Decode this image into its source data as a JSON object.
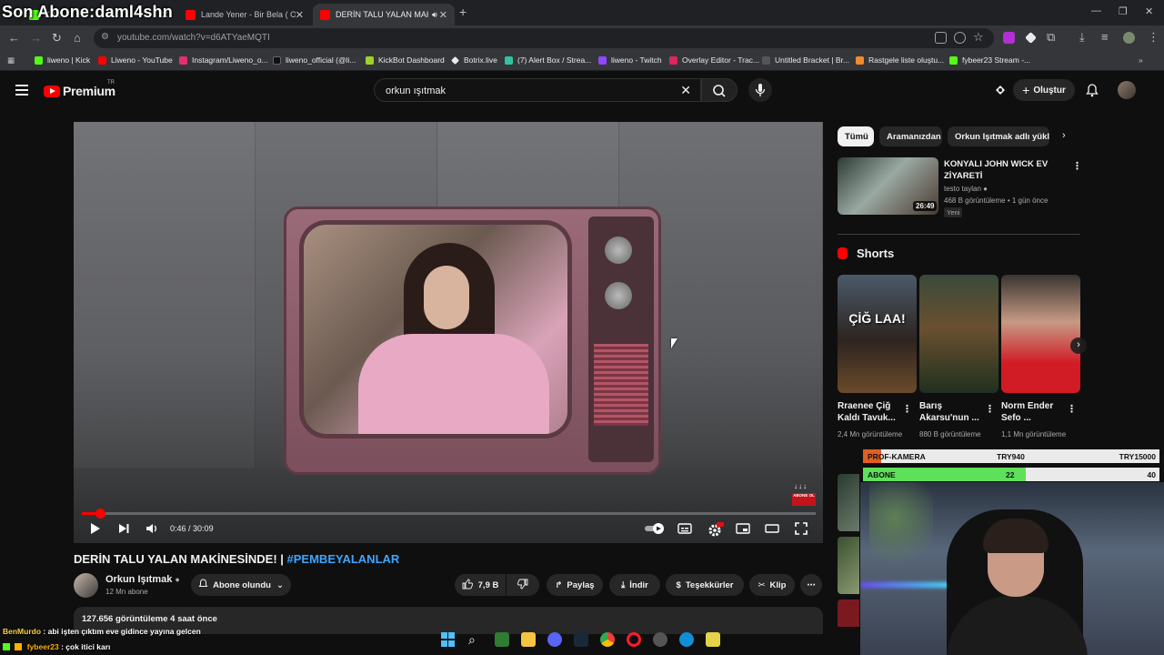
{
  "overlay": {
    "streamer_text": "Son Abone:daml4shn"
  },
  "browser": {
    "tabs": [
      {
        "label": "Kick",
        "active": false
      },
      {
        "label": "Lande Yener - Bir Bela ( Official",
        "active": false
      },
      {
        "label": "DERİN TALU YALAN MAKİN",
        "active": true
      }
    ],
    "url": "youtube.com/watch?v=d6ATYaeMQTI",
    "bookmarks": [
      "liweno | Kick",
      "Liweno - YouTube",
      "Instagram/Liweno_o...",
      "liweno_official (@li...",
      "KickBot Dashboard",
      "Botrix.live",
      "(7) Alert Box / Strea...",
      "liweno - Twitch",
      "Overlay Editor - Trac...",
      "Untitled Bracket | Br...",
      "Rastgele liste oluştu...",
      "fybeer23 Stream -..."
    ]
  },
  "youtube": {
    "logo_text": "Premium",
    "logo_region": "TR",
    "search_query": "orkun ışıtmak",
    "create_label": "Oluştur",
    "player": {
      "current_time": "0:46",
      "duration": "30:09",
      "progress": 0.025,
      "badge_text": "ABONE OL"
    },
    "video": {
      "title": "DERİN TALU YALAN MAKİNESİNDE! | ",
      "hashtag": "#PEMBEYALANLAR",
      "channel": "Orkun Işıtmak",
      "subscribers": "12 Mn abone",
      "subscribed_label": "Abone olundu",
      "likes": "7,9 B",
      "share_label": "Paylaş",
      "download_label": "İndir",
      "thanks_label": "Teşekkürler",
      "clip_label": "Klip",
      "views": "127.656 görüntüleme  4 saat önce"
    },
    "chips": [
      "Tümü",
      "Aramanızdan",
      "Orkun Işıtmak adlı yükle"
    ],
    "recommended": {
      "title": "KONYALI JOHN WICK EV ZİYARETİ",
      "channel": "testo taylan",
      "meta": "468 B görüntüleme • 1 gün önce",
      "badge": "Yeni",
      "duration": "26:49"
    },
    "shorts_heading": "Shorts",
    "shorts": [
      {
        "title": "Rraenee Çiğ Kaldı Tavuk...",
        "views": "2,4 Mn görüntüleme",
        "thumb_text": "ÇİĞ LAA!"
      },
      {
        "title": "Barış Akarsu'nun ...",
        "views": "880 B görüntüleme",
        "thumb_text": ""
      },
      {
        "title": "Norm Ender Sefo ...",
        "views": "1,1 Mn görüntüleme",
        "thumb_text": ""
      }
    ]
  },
  "stream": {
    "goals": [
      {
        "label": "PROF-KAMERA",
        "current": "TRY940",
        "target": "TRY15000",
        "fraction": 0.06,
        "color": "#e05f22"
      },
      {
        "label": "ABONE",
        "current": "22",
        "target": "40",
        "fraction": 0.55,
        "color": "#5ee05a"
      }
    ],
    "chat": [
      {
        "user": "BenMurdo",
        "message": "abi işten çıktım eve gidince yayına gelcen"
      },
      {
        "user": "fybeer23",
        "message": "çok itici karı"
      }
    ]
  }
}
